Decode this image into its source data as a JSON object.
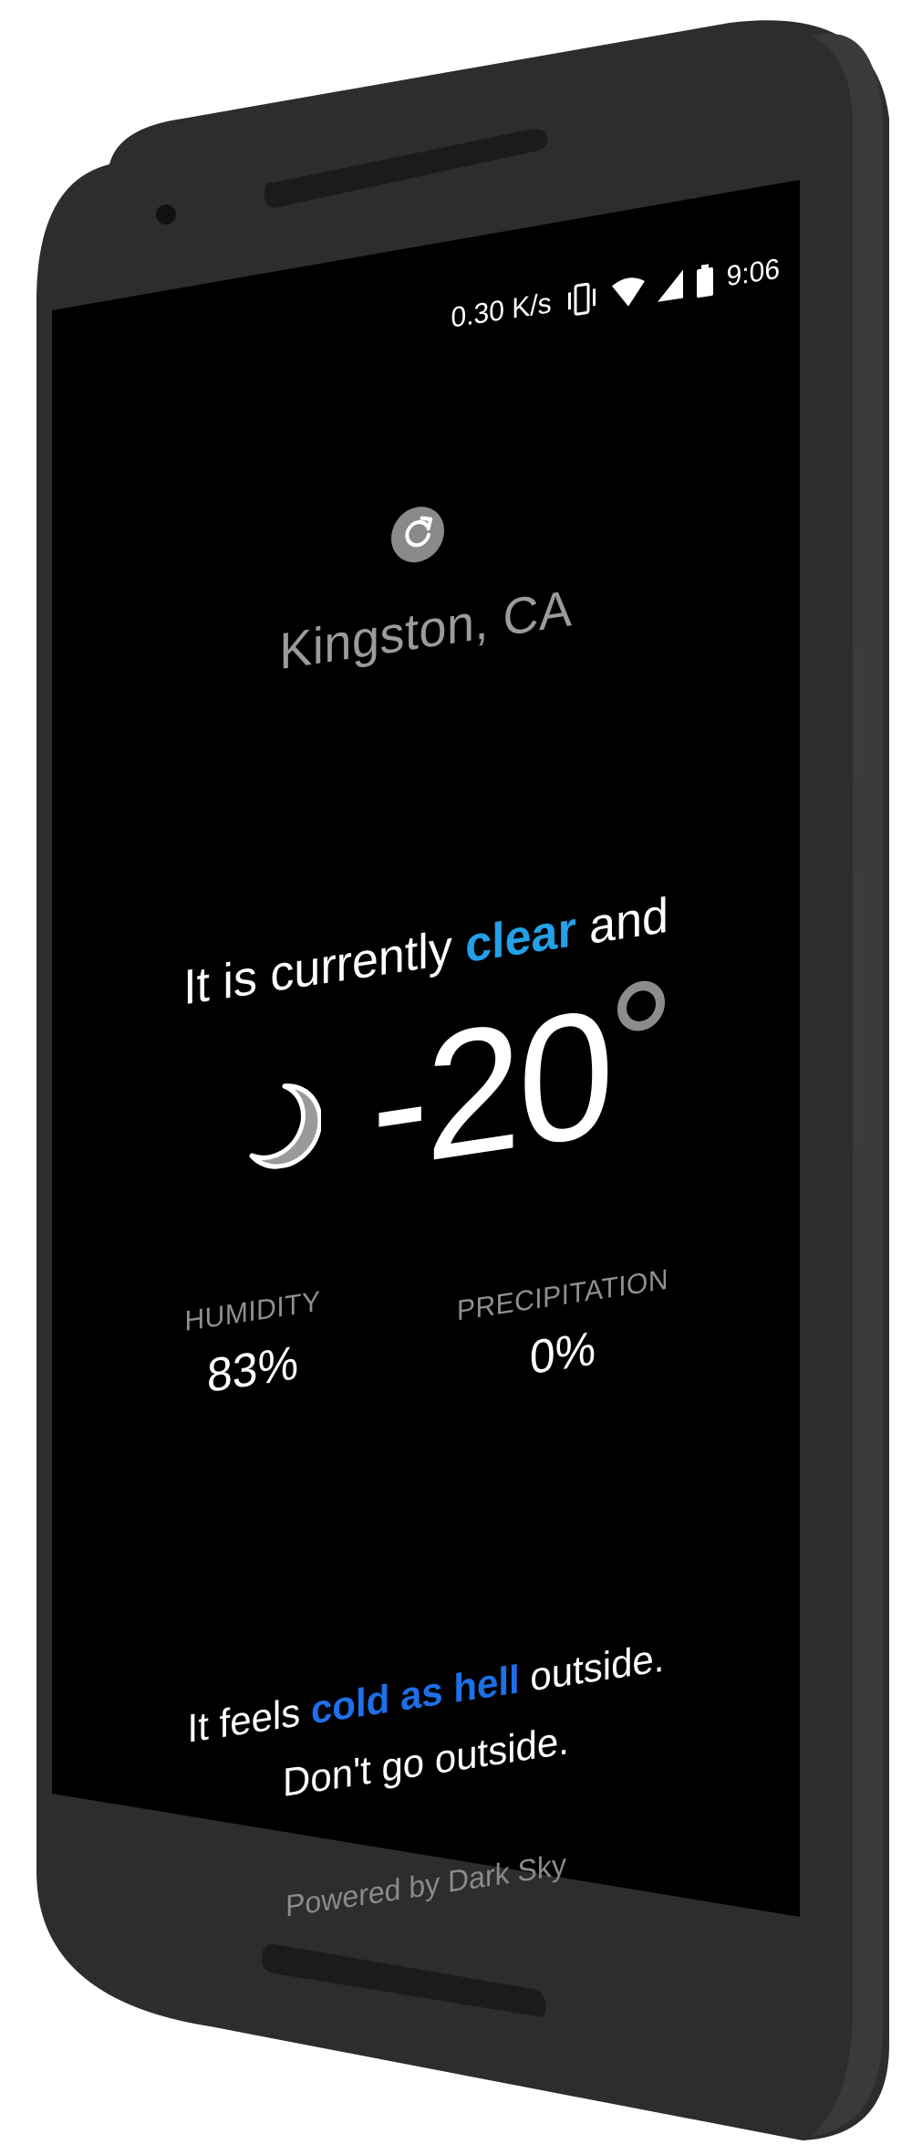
{
  "status_bar": {
    "net_speed": "0.30 K/s",
    "time": "9:06",
    "icons": [
      "vibrate-icon",
      "wifi-icon",
      "cell-signal-icon",
      "battery-icon"
    ]
  },
  "app": {
    "refresh_icon": "refresh-icon",
    "location": "Kingston, CA",
    "current_prefix": "It is currently",
    "current_condition": "clear",
    "current_suffix": "and",
    "condition_icon": "moon-icon",
    "temperature": "-20",
    "humidity_label": "HUMIDITY",
    "humidity_value": "83%",
    "precipitation_label": "PRECIPITATION",
    "precipitation_value": "0%",
    "feels_prefix": "It feels",
    "feels_phrase": "cold as hell",
    "feels_suffix": "outside.",
    "advice": "Don't go outside.",
    "powered_by": "Powered by Dark Sky"
  },
  "colors": {
    "background": "#000000",
    "condition_accent": "#23a0e8",
    "feels_accent": "#1e6fe8",
    "muted_text": "#9b9b9b",
    "phone_body": "#2c2c2c"
  }
}
